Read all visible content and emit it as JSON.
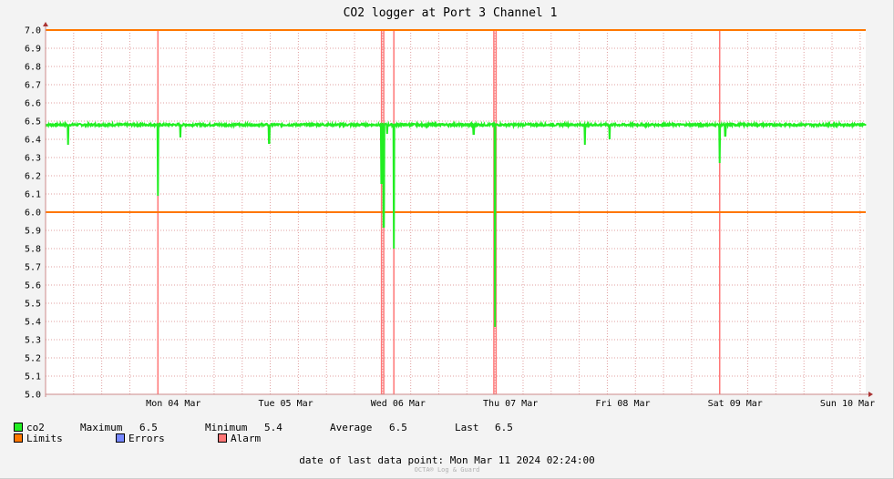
{
  "chart_data": {
    "type": "line",
    "title": "CO2 logger at Port 3 Channel 1",
    "ylim": [
      5.0,
      7.0
    ],
    "y_ticks": [
      "5.0",
      "5.1",
      "5.2",
      "5.3",
      "5.4",
      "5.5",
      "5.6",
      "5.7",
      "5.8",
      "5.9",
      "6.0",
      "6.1",
      "6.2",
      "6.3",
      "6.4",
      "6.5",
      "6.6",
      "6.7",
      "6.8",
      "6.9",
      "7.0"
    ],
    "x_range_days": [
      3.0,
      10.3
    ],
    "x_ticks": [
      {
        "label": "Mon 04 Mar",
        "day": 4
      },
      {
        "label": "Tue 05 Mar",
        "day": 5
      },
      {
        "label": "Wed 06 Mar",
        "day": 6
      },
      {
        "label": "Thu 07 Mar",
        "day": 7
      },
      {
        "label": "Fri 08 Mar",
        "day": 8
      },
      {
        "label": "Sat 09 Mar",
        "day": 9
      },
      {
        "label": "Sun 10 Mar",
        "day": 10
      }
    ],
    "limits": [
      6.0,
      7.0
    ],
    "alarms_days": [
      4.0,
      5.99,
      6.01,
      6.1,
      6.99,
      7.01,
      9.0
    ],
    "series": [
      {
        "name": "co2",
        "color": "#22ee22",
        "baseline": 6.48,
        "dips": [
          {
            "day": 3.2,
            "value": 6.37
          },
          {
            "day": 4.0,
            "value": 6.09
          },
          {
            "day": 4.2,
            "value": 6.41
          },
          {
            "day": 4.99,
            "value": 6.38
          },
          {
            "day": 5.99,
            "value": 6.16
          },
          {
            "day": 6.01,
            "value": 5.92
          },
          {
            "day": 6.04,
            "value": 6.43
          },
          {
            "day": 6.1,
            "value": 5.8
          },
          {
            "day": 6.81,
            "value": 6.43
          },
          {
            "day": 7.0,
            "value": 5.37
          },
          {
            "day": 7.8,
            "value": 6.37
          },
          {
            "day": 8.02,
            "value": 6.4
          },
          {
            "day": 9.0,
            "value": 6.27
          },
          {
            "day": 9.05,
            "value": 6.42
          }
        ]
      }
    ]
  },
  "legend": {
    "series_name": "co2",
    "maximum_label": "Maximum",
    "maximum_value": "6.5",
    "minimum_label": "Minimum",
    "minimum_value": "5.4",
    "average_label": "Average",
    "average_value": "6.5",
    "last_label": "Last",
    "last_value": "6.5",
    "limits_label": "Limits",
    "errors_label": "Errors",
    "alarm_label": "Alarm"
  },
  "colors": {
    "co2": "#22ee22",
    "limits": "#ff7700",
    "errors": "#7788ff",
    "alarm": "#ff7777",
    "grid": "#e0a0a0",
    "axis": "#cc8888",
    "plot_bg": "#ffffff"
  },
  "footer": {
    "last_point": "date of last data point:  Mon Mar 11 2024 02:24:00",
    "credit": "OCTA® Log & Guard"
  }
}
